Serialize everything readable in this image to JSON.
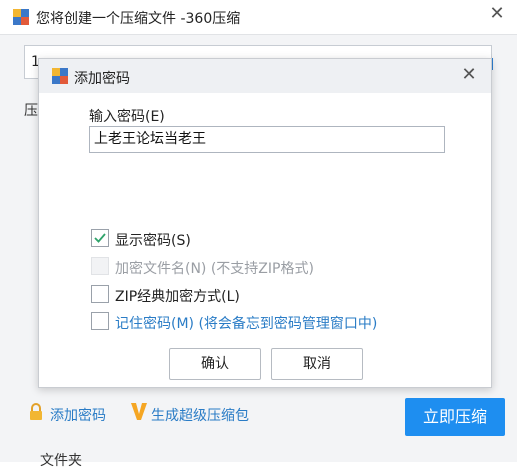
{
  "main_window": {
    "title": "您将创建一个压缩文件 -360压缩",
    "close_glyph": "✕",
    "path_value": "1",
    "label_ya": "压",
    "add_password_link": "添加密码",
    "super_compress_link": "生成超级压缩包",
    "compress_now_button": "立即压缩",
    "folder_label": "文件夹"
  },
  "dialog": {
    "title": "添加密码",
    "close_glyph": "✕",
    "password_label": "输入密码(E)",
    "password_value": "上老王论坛当老王",
    "show_password": {
      "label": "显示密码(S)",
      "checked": true
    },
    "encrypt_filenames": {
      "label": "加密文件名(N) (不支持ZIP格式)",
      "checked": false,
      "disabled": true
    },
    "zip_classic": {
      "label": "ZIP经典加密方式(L)",
      "checked": false
    },
    "remember_password": {
      "label": "记住密码(M) (将会备忘到密码管理窗口中)",
      "checked": false
    },
    "ok_button": "确认",
    "cancel_button": "取消"
  },
  "colors": {
    "accent": "#1e8ef0",
    "link": "#2a7cc6",
    "check": "#2fa36b"
  }
}
